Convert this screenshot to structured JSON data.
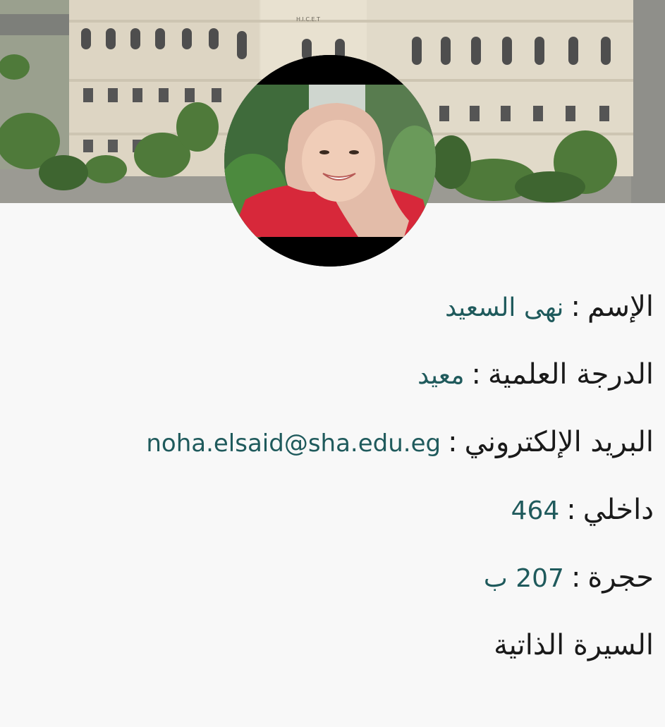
{
  "banner": {
    "building_sign": "H.I.C.E.T",
    "colors": {
      "sky": "#cfcac0",
      "building": "#e7e1d2",
      "trees": "#4f7a3a",
      "road": "#8a8a8a"
    }
  },
  "profile": {
    "photo_icon": "person-photo-icon",
    "fields": [
      {
        "label": "الإسم",
        "separator": ":",
        "value": "نهى السعيد"
      },
      {
        "label": "الدرجة العلمية",
        "separator": ":",
        "value": "معيد"
      },
      {
        "label": "البريد الإلكتروني",
        "separator": ":",
        "value": "noha.elsaid@sha.edu.eg"
      },
      {
        "label": "داخلي",
        "separator": ":",
        "value": "464"
      },
      {
        "label": "حجرة",
        "separator": ":",
        "value": "207 ب"
      }
    ],
    "cv_link": "السيرة الذاتية"
  },
  "theme": {
    "label_color": "#1a1a1a",
    "value_color": "#1f5a5c",
    "background": "#f8f8f8"
  }
}
